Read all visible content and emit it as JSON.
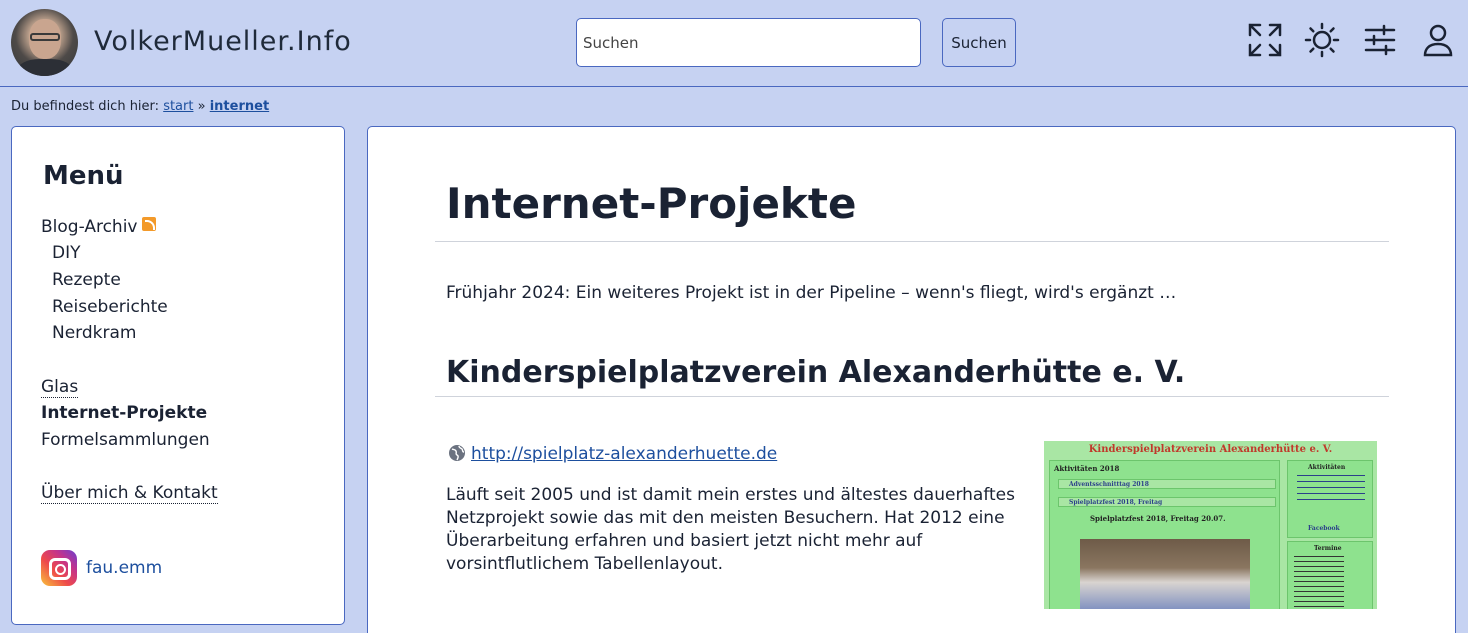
{
  "header": {
    "site_title": "VolkerMueller.Info",
    "search_placeholder": "Suchen",
    "search_button": "Suchen",
    "icons": [
      "fullscreen-icon",
      "sun-icon",
      "sliders-icon",
      "user-icon"
    ]
  },
  "breadcrumb": {
    "prefix": "Du befindest dich hier:",
    "items": [
      "start",
      "internet"
    ],
    "separator": "»"
  },
  "sidebar": {
    "title": "Menü",
    "blog_archive": "Blog-Archiv",
    "sub_items": [
      "DIY",
      "Rezepte",
      "Reiseberichte",
      "Nerdkram"
    ],
    "items": [
      "Glas",
      "Internet-Projekte",
      "Formelsammlungen"
    ],
    "about": "Über mich & Kontakt",
    "instagram": "fau.emm"
  },
  "main": {
    "title": "Internet-Projekte",
    "intro": "Frühjahr 2024: Ein weiteres Projekt ist in der Pipeline – wenn's fliegt, wird's ergänzt …",
    "project": {
      "heading": "Kinderspielplatzverein Alexanderhütte e. V.",
      "link": "http://spielplatz-alexanderhuette.de",
      "description": "Läuft seit 2005 und ist damit mein erstes und ältestes dauerhaftes Netzprojekt sowie das mit den meisten Besuchern. Hat 2012 eine Überarbeitung erfahren und basiert jetzt nicht mehr auf vorsintflutlichem Tabellenlayout.",
      "thumbnail": {
        "title": "Kinderspielplatzverein Alexanderhütte e. V.",
        "section": "Aktivitäten 2018",
        "event1": "Adventsschnitttag 2018",
        "event2": "Spielplatzfest 2018, Freitag",
        "event_title": "Spielplatzfest 2018, Freitag 20.07.",
        "side1": "Aktivitäten",
        "side2": "Termine",
        "facebook": "Facebook"
      }
    }
  }
}
